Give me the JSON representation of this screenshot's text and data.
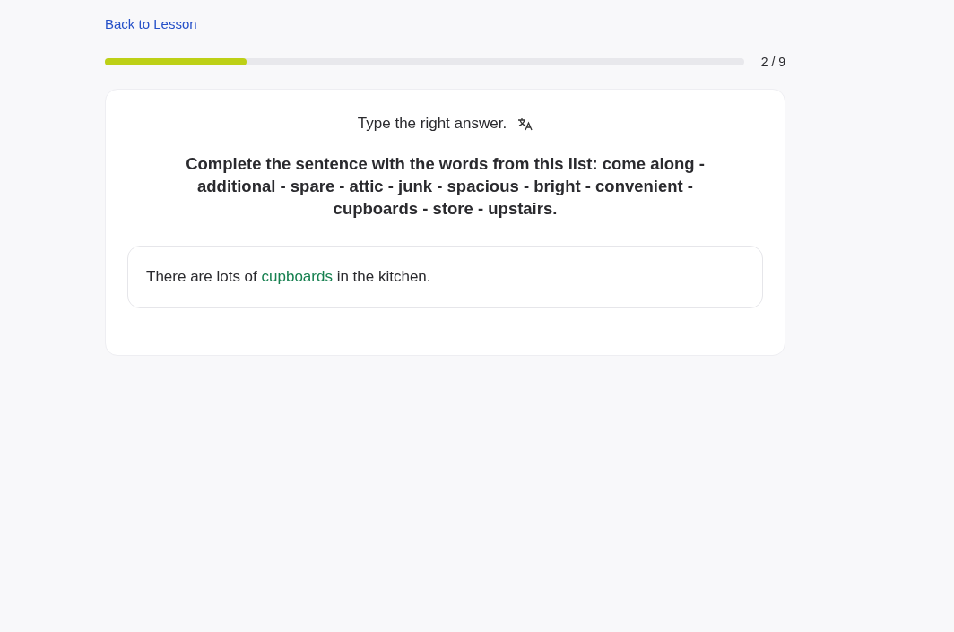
{
  "back_link": "Back to Lesson",
  "progress": {
    "level": 0.222,
    "counter": "2 / 9"
  },
  "instruction": "Type the right answer.",
  "question": "Complete the sentence with the words from this list: come along - additional - spare - attic - junk - spacious - bright - convenient - cupboards - store - upstairs.",
  "sentence": {
    "before": "There are lots of ",
    "answer": "cupboards",
    "correct": true,
    "after": " in the kitchen."
  }
}
